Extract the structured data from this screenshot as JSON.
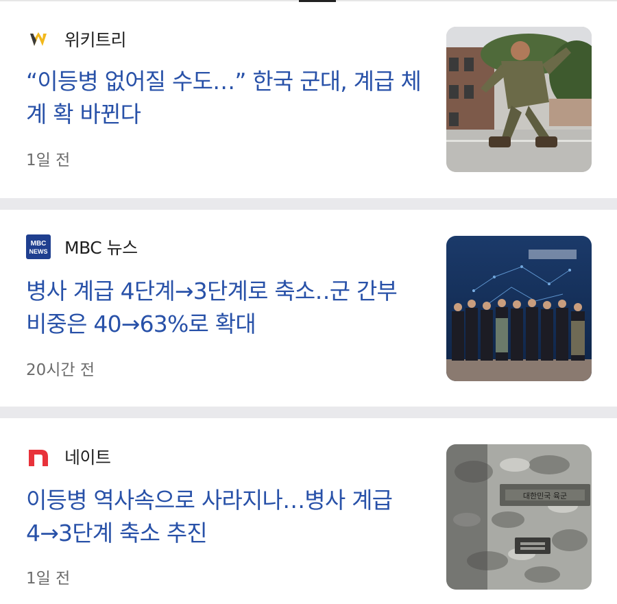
{
  "articles": [
    {
      "source": "위키트리",
      "source_logo": "wikitree-logo",
      "headline": "“이등병 없어질 수도…” 한국 군대, 계급 체계 확 바뀐다",
      "time": "1일 전"
    },
    {
      "source": "MBC 뉴스",
      "source_logo": "mbc-news-logo",
      "logo_text": "MBC NEWS",
      "headline": "병사 계급 4단계→3단계로 축소‥군 간부 비중은 40→63%로 확대",
      "time": "20시간 전"
    },
    {
      "source": "네이트",
      "source_logo": "nate-logo",
      "headline": "이등병 역사속으로 사라지나…병사 계급 4→3단계 축소 추진",
      "time": "1일 전"
    }
  ],
  "colors": {
    "headline": "#2851a8",
    "source_text": "#1f1f1f",
    "time_text": "#6b6b6b",
    "separator": "#e9e9ec",
    "wikitree_yellow": "#f2b81c",
    "mbc_blue": "#1f3f8f",
    "nate_red": "#e8323a"
  }
}
